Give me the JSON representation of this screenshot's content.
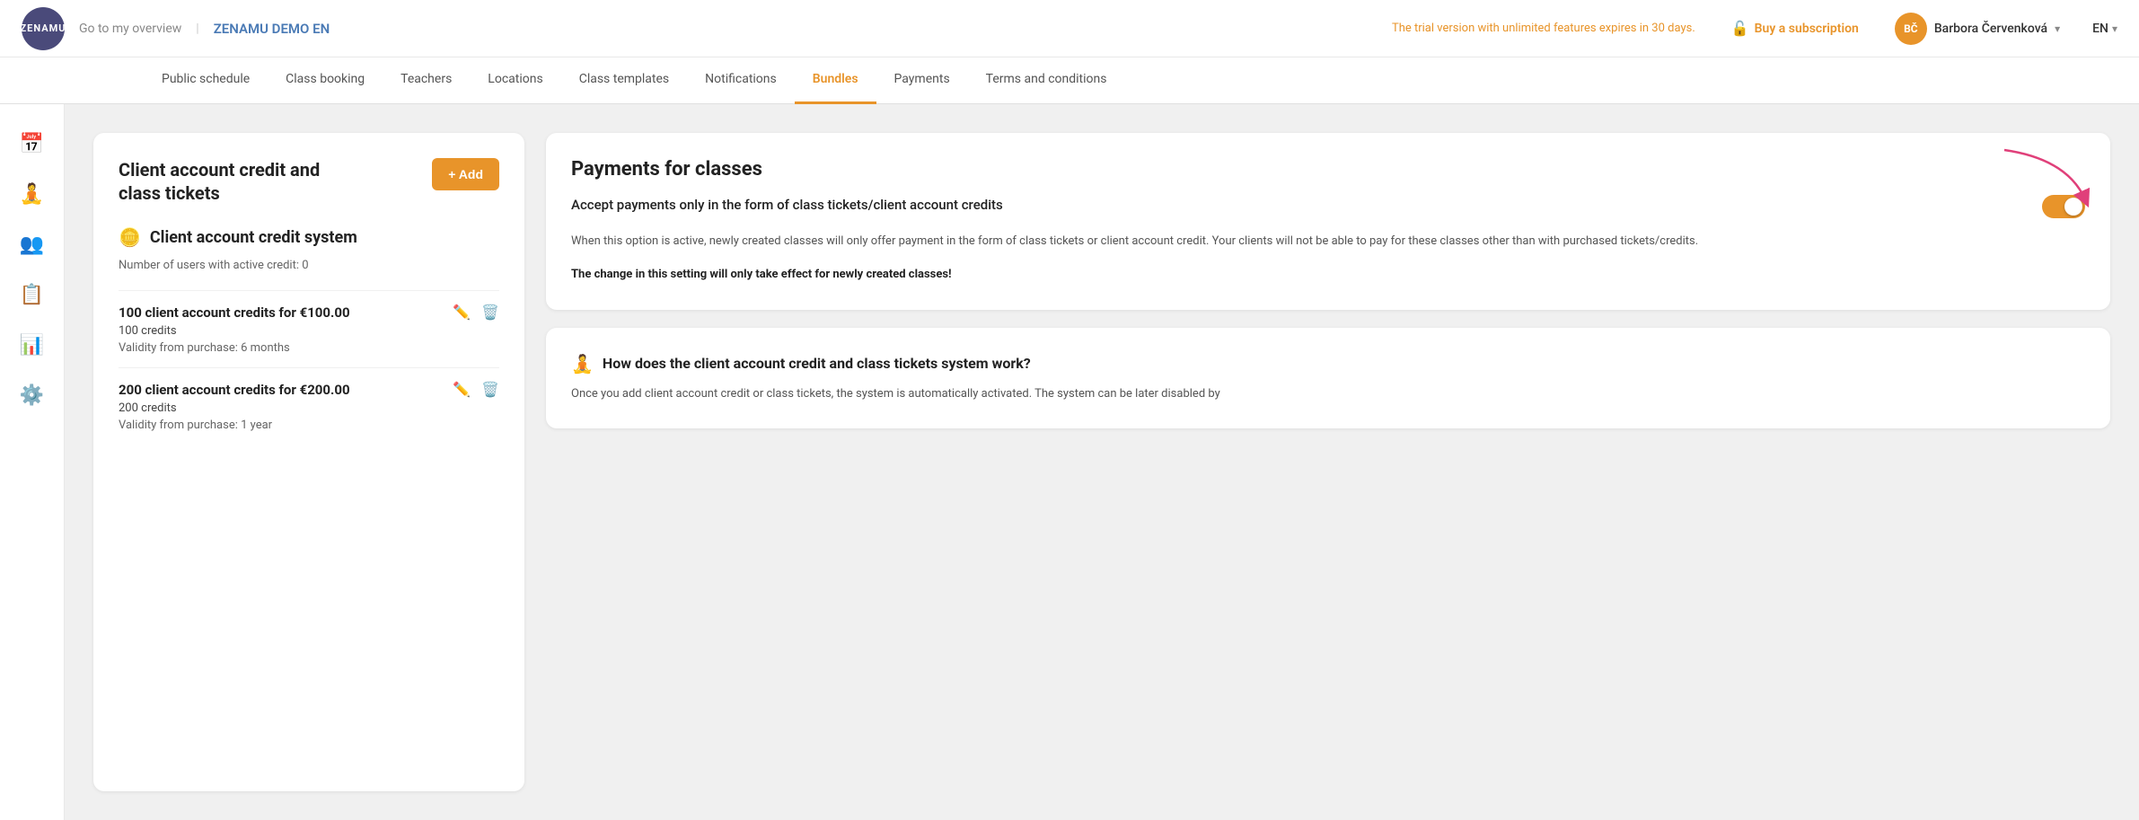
{
  "topbar": {
    "logo_text": "ZENAMU",
    "go_to_overview": "Go to my overview",
    "demo_title": "ZENAMU DEMO EN",
    "trial_notice": "The trial version with unlimited features expires in 30 days.",
    "buy_subscription": "Buy a subscription",
    "user_initials": "BČ",
    "user_name": "Barbora Červenková",
    "lang": "EN"
  },
  "nav": {
    "items": [
      {
        "label": "Public schedule",
        "active": false
      },
      {
        "label": "Class booking",
        "active": false
      },
      {
        "label": "Teachers",
        "active": false
      },
      {
        "label": "Locations",
        "active": false
      },
      {
        "label": "Class templates",
        "active": false
      },
      {
        "label": "Notifications",
        "active": false
      },
      {
        "label": "Bundles",
        "active": true
      },
      {
        "label": "Payments",
        "active": false
      },
      {
        "label": "Terms and conditions",
        "active": false
      }
    ]
  },
  "sidebar": {
    "icons": [
      {
        "name": "calendar-icon",
        "symbol": "📅"
      },
      {
        "name": "person-icon",
        "symbol": "🧘"
      },
      {
        "name": "group-icon",
        "symbol": "👥"
      },
      {
        "name": "document-icon",
        "symbol": "📋"
      },
      {
        "name": "chart-icon",
        "symbol": "📊"
      },
      {
        "name": "settings-icon",
        "symbol": "⚙️"
      }
    ]
  },
  "left_panel": {
    "title": "Client account credit and\nclass tickets",
    "add_button": "+ Add",
    "section_icon": "🪙",
    "section_title": "Client account credit system",
    "active_users_label": "Number of users with active credit: 0",
    "credits": [
      {
        "name": "100 client account credits for €100.00",
        "credits_label": "100 credits",
        "validity": "Validity from purchase: 6 months"
      },
      {
        "name": "200 client account credits for €200.00",
        "credits_label": "200 credits",
        "validity": "Validity from purchase: 1 year"
      }
    ]
  },
  "right_panel": {
    "payments_card": {
      "title": "Payments for classes",
      "setting_text": "Accept payments only in the form of class tickets/client account credits",
      "toggle_enabled": true,
      "description": "When this option is active, newly created classes will only offer payment in the form of class tickets or client account credit. Your clients will not be able to pay for these classes other than with purchased tickets/credits.",
      "note": "The change in this setting will only take effect for newly created classes!"
    },
    "how_works_card": {
      "icon": "🧘",
      "title": "How does the client account credit and class tickets system work?",
      "body": "Once you add client account credit or class tickets, the system is automatically activated. The system can be later disabled by"
    }
  }
}
